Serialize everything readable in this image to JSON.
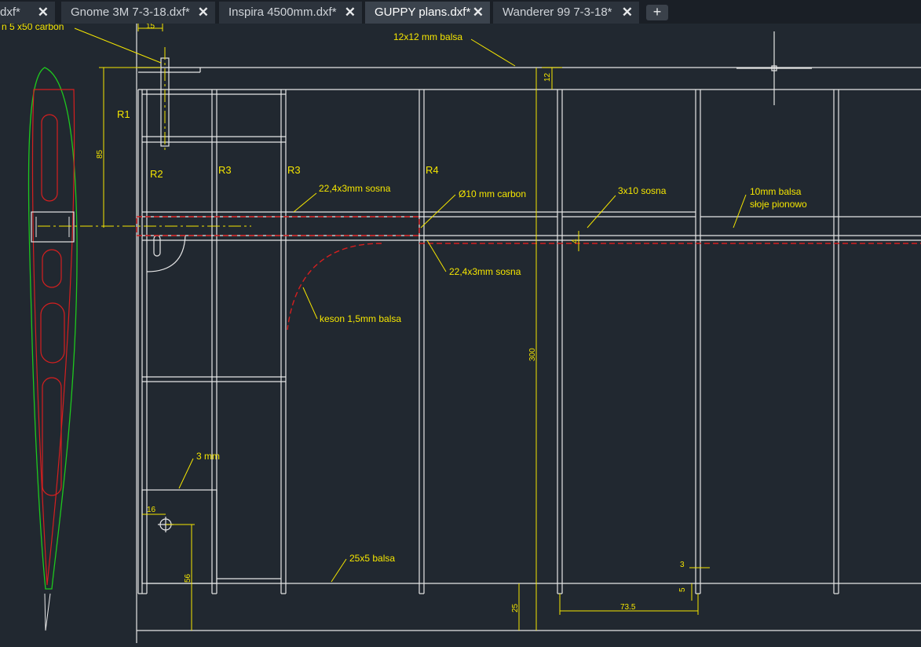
{
  "tabs": [
    {
      "label": "dxf*",
      "active": false
    },
    {
      "label": "Gnome 3M 7-3-18.dxf*",
      "active": false
    },
    {
      "label": "Inspira 4500mm.dxf*",
      "active": false
    },
    {
      "label": "GUPPY plans.dxf*",
      "active": true
    },
    {
      "label": "Wanderer 99 7-3-18*",
      "active": false
    }
  ],
  "tab_close_glyph": "✕",
  "new_tab_glyph": "+",
  "drawing": {
    "labels": {
      "carbon_top": "n 5 x50 carbon",
      "balsa_12": "12x12 mm balsa",
      "r1": "R1",
      "r2": "R2",
      "r3a": "R3",
      "r3b": "R3",
      "r4": "R4",
      "sosna_top": "22,4x3mm sosna",
      "carbon_10": "Ø10 mm carbon",
      "sosna_3x10": "3x10 sosna",
      "balsa_10mm_1": "10mm balsa",
      "balsa_10mm_2": "słoje pionowo",
      "sosna_bottom": "22,4x3mm sosna",
      "keson": "keson 1,5mm balsa",
      "mm3": "3 mm",
      "balsa_25x5": "25x5 balsa"
    },
    "dims": {
      "d15": "15",
      "d12": "12",
      "d85": "85",
      "d300": "300",
      "d4": "4",
      "d16": "16",
      "d56": "56",
      "d25": "25",
      "d3": "3",
      "d5": "5",
      "d735": "73.5"
    },
    "colors": {
      "background": "#212830",
      "lines": "#e6e6e6",
      "annotation": "#f5e600",
      "hidden": "#d61f1f",
      "profile": "#1ec81e"
    }
  }
}
